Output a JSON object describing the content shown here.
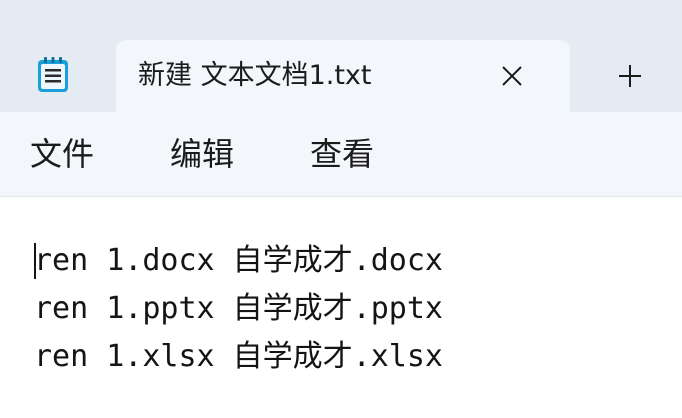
{
  "tab": {
    "title": "新建 文本文档1.txt",
    "close_icon": "close-icon",
    "new_tab_icon": "plus-icon"
  },
  "app_icon": "notepad-icon",
  "menu": {
    "items": [
      {
        "label": "文件"
      },
      {
        "label": "编辑"
      },
      {
        "label": "查看"
      }
    ]
  },
  "editor": {
    "lines": [
      "ren 1.docx 自学成才.docx",
      "ren 1.pptx 自学成才.pptx",
      "ren 1.xlsx 自学成才.xlsx"
    ]
  },
  "colors": {
    "titlebar_bg": "#e5ebf3",
    "tab_bg": "#f3f6fa",
    "text": "#1b1b1b",
    "icon_accent": "#1a9fd8"
  }
}
